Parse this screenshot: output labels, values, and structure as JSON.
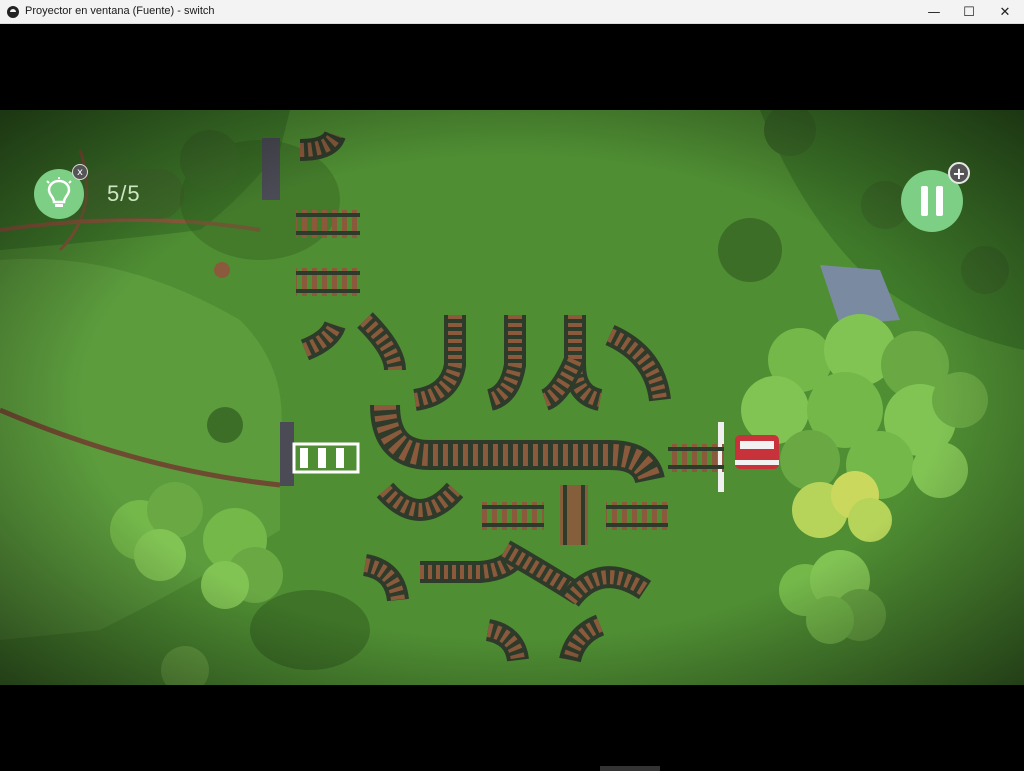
{
  "window": {
    "title": "Proyector en ventana (Fuente) - switch",
    "minimize_glyph": "—",
    "maximize_glyph": "☐",
    "close_glyph": "✕"
  },
  "hud": {
    "hint_icon": "lightbulb-icon",
    "hint_close_glyph": "x",
    "hint_count": "5/5",
    "pause_icon": "pause-icon",
    "add_glyph": "+"
  },
  "colors": {
    "grass": "#4f8e33",
    "grass_light": "#6aa844",
    "rail_tie": "#8b5a3c",
    "rail_steel": "#2e3b2a",
    "button_green": "#7ccf84",
    "tree": "#74b84a",
    "train_red": "#c8323a"
  }
}
